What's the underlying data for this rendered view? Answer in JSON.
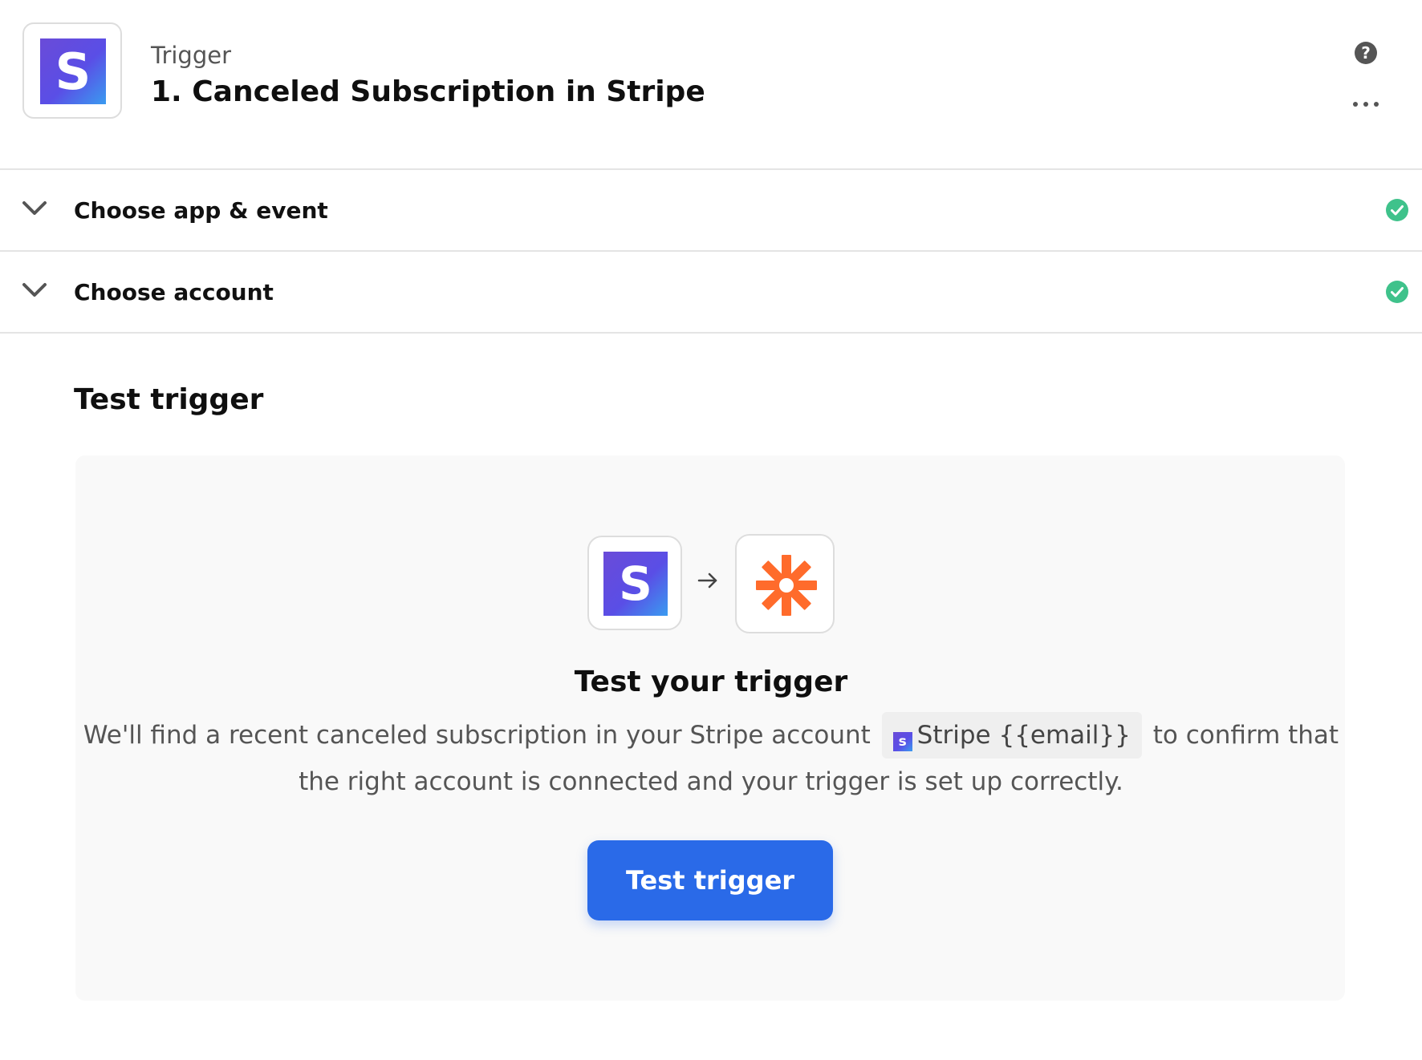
{
  "header": {
    "app_logo_letter": "S",
    "kicker": "Trigger",
    "title": "1. Canceled Subscription in Stripe",
    "help_icon": "?"
  },
  "sections": [
    {
      "label": "Choose app & event",
      "status": "complete"
    },
    {
      "label": "Choose account",
      "status": "complete"
    }
  ],
  "test": {
    "heading": "Test trigger",
    "flow_from_letter": "S",
    "card_title": "Test your trigger",
    "desc_before": "We'll find a recent canceled subscription in your Stripe account",
    "account_chip_letter": "s",
    "account_chip_label": "Stripe {{email}}",
    "desc_after": "to confirm that the right account is connected and your trigger is set up correctly.",
    "button_label": "Test trigger"
  },
  "colors": {
    "accent": "#2a6ae8",
    "success": "#3fc28b",
    "zap_orange": "#ff6b2b",
    "stripe_purple": "#5a4ee6"
  },
  "icons": [
    "stripe-logo-icon",
    "help-icon",
    "more-icon",
    "chevron-down-icon",
    "check-circle-icon",
    "arrow-right-icon",
    "zapier-logo-icon"
  ]
}
